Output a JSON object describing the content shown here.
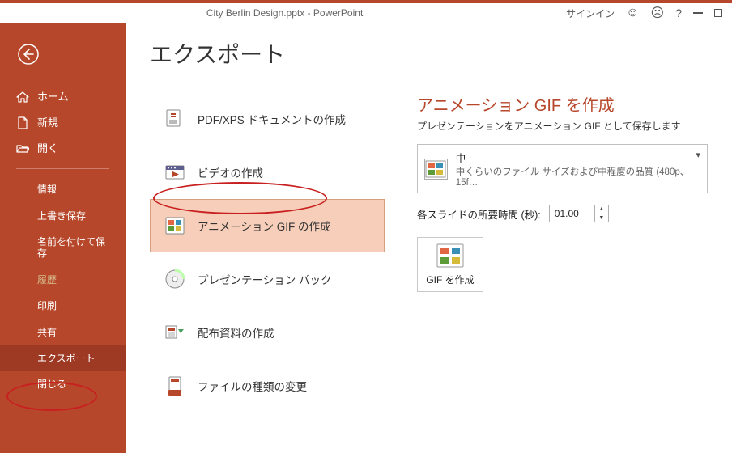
{
  "titlebar": {
    "title": "City Berlin Design.pptx  -  PowerPoint",
    "signin": "サインイン",
    "help": "?"
  },
  "sidebar": {
    "home": "ホーム",
    "new": "新規",
    "open": "開く",
    "info": "情報",
    "save": "上書き保存",
    "saveas": "名前を付けて保存",
    "history": "履歴",
    "print": "印刷",
    "share": "共有",
    "export": "エクスポート",
    "close": "閉じる"
  },
  "page": {
    "title": "エクスポート"
  },
  "export_items": [
    {
      "label": "PDF/XPS ドキュメントの作成"
    },
    {
      "label": "ビデオの作成"
    },
    {
      "label": "アニメーション GIF の作成"
    },
    {
      "label": "プレゼンテーション パック"
    },
    {
      "label": "配布資料の作成"
    },
    {
      "label": "ファイルの種類の変更"
    }
  ],
  "right": {
    "heading": "アニメーション GIF を作成",
    "sub": "プレゼンテーションをアニメーション GIF として保存します",
    "quality": {
      "line1": "中",
      "line2": "中くらいのファイル サイズおよび中程度の品質 (480p、15f…"
    },
    "time_label": "各スライドの所要時間 (秒):",
    "time_value": "01.00",
    "create_label": "GIF を作成"
  }
}
